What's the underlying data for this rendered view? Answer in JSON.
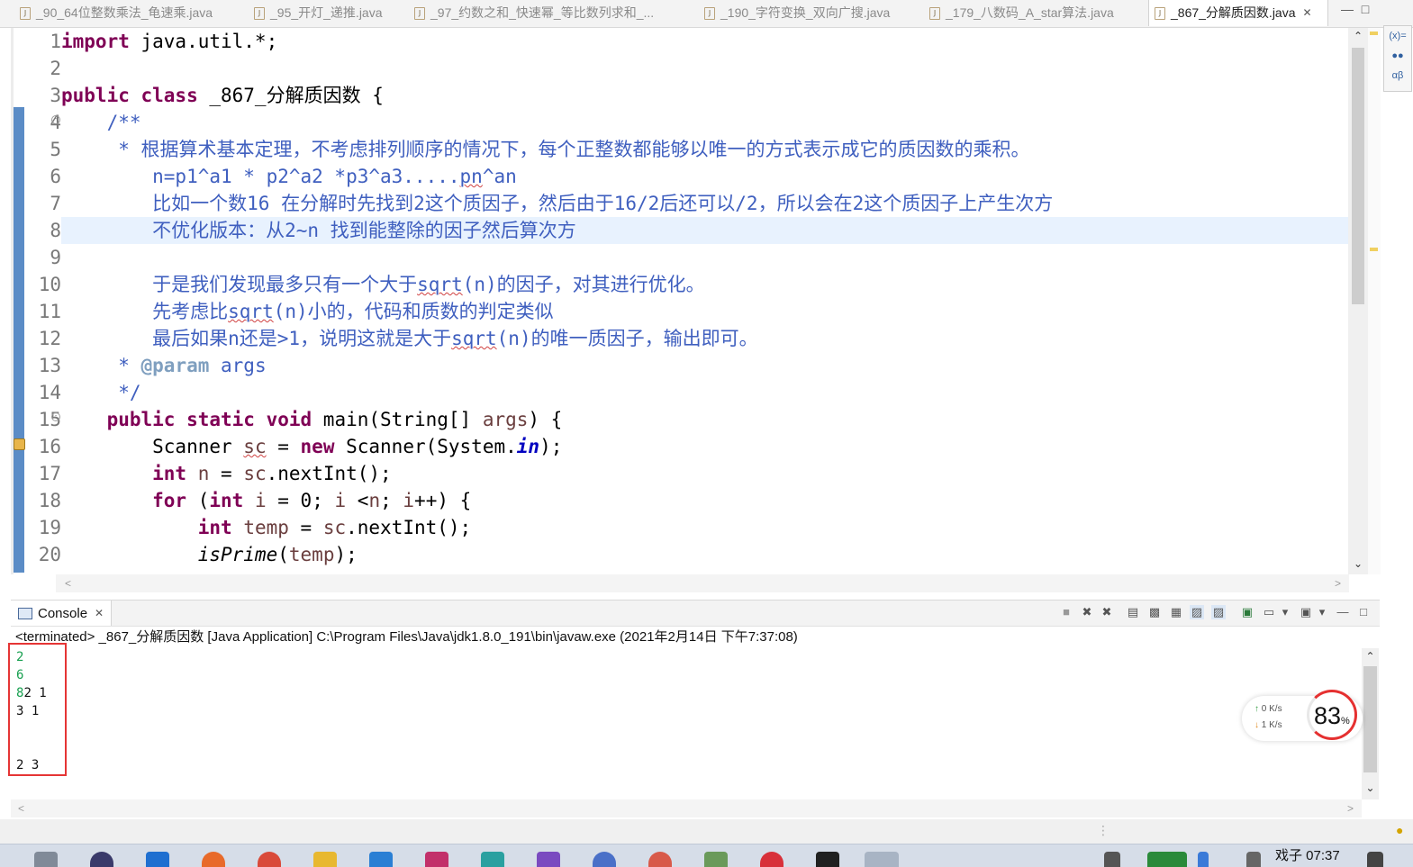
{
  "tabs": [
    {
      "label": "_90_64位整数乘法_龟速乘.java",
      "active": false
    },
    {
      "label": "_95_开灯_递推.java",
      "active": false
    },
    {
      "label": "_97_约数之和_快速幂_等比数列求和_...",
      "active": false
    },
    {
      "label": "_190_字符变换_双向广搜.java",
      "active": false
    },
    {
      "label": "_179_八数码_A_star算法.java",
      "active": false
    },
    {
      "label": "_867_分解质因数.java",
      "active": true
    }
  ],
  "tab_close_glyph": "✕",
  "editor": {
    "line_numbers": [
      "1",
      "2",
      "3",
      "4",
      "5",
      "6",
      "7",
      "8",
      "9",
      "10",
      "11",
      "12",
      "13",
      "14",
      "15",
      "16",
      "17",
      "18",
      "19",
      "20"
    ],
    "current_line": 8
  },
  "code": {
    "l1_kw": "import",
    "l1_rest": " java.util.*;",
    "l3_kw": "public class",
    "l3_rest": " _867_分解质因数 {",
    "l4": "    /**",
    "l5": "     * 根据算术基本定理，不考虑排列顺序的情况下，每个正整数都能够以唯一的方式表示成它的质因数的乘积。",
    "l6_a": "        n=p1^a1 * p2^a2 *p3^a3.....",
    "l6_sq": "pn",
    "l6_b": "^an",
    "l7": "        比如一个数16 在分解时先找到2这个质因子，然后由于16/2后还可以/2，所以会在2这个质因子上产生次方",
    "l8": "        不优化版本：从2~n 找到能整除的因子然后算次方",
    "l10_a": "        于是我们发现最多只有一个大于",
    "l10_sq": "sqrt",
    "l10_b": "(n)的因子，对其进行优化。",
    "l11_a": "        先考虑比",
    "l11_sq": "sqrt",
    "l11_b": "(n)小的，代码和质数的判定类似",
    "l12_a": "        最后如果n还是>1，说明这就是大于",
    "l12_sq": "sqrt",
    "l12_b": "(n)的唯一质因子，输出即可。",
    "l13_a": "     * ",
    "l13_ann": "@param",
    "l13_b": " args",
    "l14": "     */",
    "l15_kw": "    public static void",
    "l15_rest": " main(String[] ",
    "l15_var": "args",
    "l15_end": ") {",
    "l16_a": "        Scanner ",
    "l16_var": "sc",
    "l16_b": " = ",
    "l16_kw": "new",
    "l16_c": " Scanner(System.",
    "l16_fld": "in",
    "l16_d": ");",
    "l17_kw": "        int",
    "l17_a": " ",
    "l17_var": "n",
    "l17_b": " = ",
    "l17_var2": "sc",
    "l17_c": ".nextInt();",
    "l18_kw": "        for",
    "l18_a": " (",
    "l18_kw2": "int",
    "l18_b": " ",
    "l18_var": "i",
    "l18_c": " = 0; ",
    "l18_var2": "i",
    "l18_d": " <",
    "l18_var3": "n",
    "l18_e": "; ",
    "l18_var4": "i",
    "l18_f": "++) {",
    "l19_kw": "            int",
    "l19_a": " ",
    "l19_var": "temp",
    "l19_b": " = ",
    "l19_var2": "sc",
    "l19_c": ".nextInt();",
    "l20_a": "            ",
    "l20_st": "isPrime",
    "l20_b": "(",
    "l20_var": "temp",
    "l20_c": ");"
  },
  "console": {
    "tab_label": "Console",
    "tab_close": "✕",
    "title": "<terminated> _867_分解质因数 [Java Application] C:\\Program Files\\Java\\jdk1.8.0_191\\bin\\javaw.exe (2021年2月14日 下午7:37:08)",
    "out_1": "2",
    "out_2": "6",
    "out_3_in": "8",
    "out_3_out": "2 1",
    "out_4": "3 1",
    "out_5": "2 3"
  },
  "network": {
    "up": "0  K/s",
    "down": "1  K/s",
    "up_arrow": "↑",
    "down_arrow": "↓"
  },
  "cpu": {
    "value": "83",
    "unit": "%"
  },
  "taskbar": {
    "clock": "戏子 07:37"
  },
  "colors": {
    "keyword": "#7f0055",
    "comment": "#3f5fbf",
    "current_line": "#e8f2fe",
    "console_input": "#18a050",
    "highlight_box": "#e53535"
  }
}
